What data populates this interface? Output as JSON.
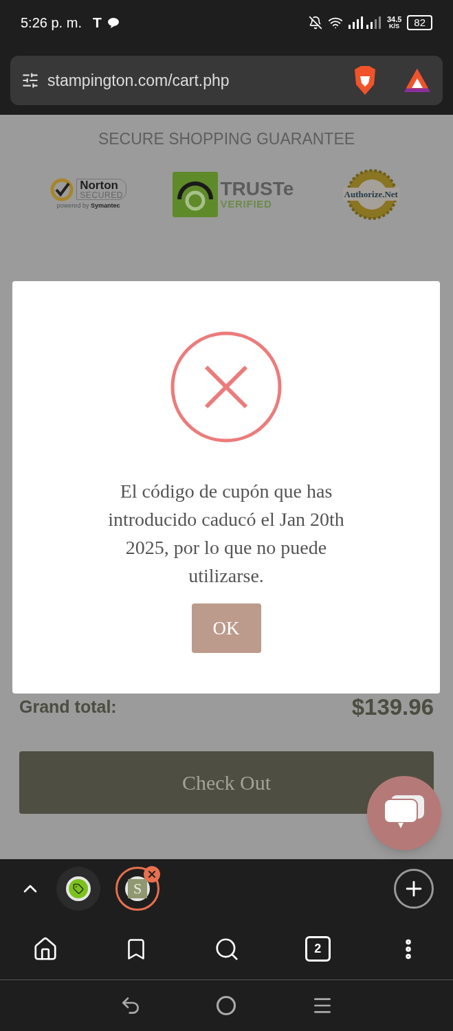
{
  "status_bar": {
    "time": "5:26 p. m.",
    "carrier_mark": "T",
    "speed": "34.5",
    "speed_unit": "K/S",
    "battery": "82"
  },
  "address_bar": {
    "url": "stampington.com/cart.php"
  },
  "page": {
    "guarantee_title": "SECURE SHOPPING GUARANTEE",
    "badges": [
      {
        "kind": "norton",
        "title": "Norton",
        "subtitle": "SECURED",
        "caption": "powered by",
        "brand": "Symantec"
      },
      {
        "kind": "truste",
        "title": "TRUSTe",
        "subtitle": "VERIFIED"
      },
      {
        "kind": "authorize",
        "title": "Authorize.Net"
      }
    ],
    "grand_total_label": "Grand total:",
    "grand_total": "$139.96",
    "checkout": "Check Out"
  },
  "dialog": {
    "message": "El código de cupón que has introducido caducó el Jan 20th 2025, por lo que no puede utilizarse.",
    "button": "OK"
  },
  "tabs": [
    {
      "kind": "tag",
      "selected": false
    },
    {
      "kind": "letter",
      "letter": "S",
      "selected": true
    }
  ],
  "toolbar": {
    "tab_count": "2"
  }
}
